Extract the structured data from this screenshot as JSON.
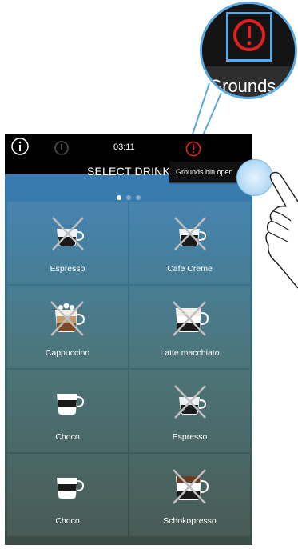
{
  "zoom_callout": {
    "label": "Grounds",
    "icon": "alert-icon"
  },
  "status_bar": {
    "time": "03:11",
    "icons": [
      "info-icon",
      "disabled-status-icon",
      "alert-icon"
    ],
    "alert_color": "#e02020"
  },
  "header": {
    "title": "SELECT DRINK"
  },
  "tooltip": {
    "text": "Grounds bin open"
  },
  "pager": {
    "pages": 3,
    "active": 1
  },
  "drinks": [
    {
      "label": "Espresso",
      "icon": "espresso-cup-icon",
      "disabled": true
    },
    {
      "label": "Cafe Creme",
      "icon": "cafe-creme-cup-icon",
      "disabled": true
    },
    {
      "label": "Cappuccino",
      "icon": "cappuccino-cup-icon",
      "disabled": true
    },
    {
      "label": "Latte macchiato",
      "icon": "latte-macchiato-cup-icon",
      "disabled": true
    },
    {
      "label": "Choco",
      "icon": "choco-cup-icon",
      "disabled": false
    },
    {
      "label": "Espresso",
      "icon": "espresso-cup-icon",
      "disabled": true
    },
    {
      "label": "Choco",
      "icon": "choco-cup-icon",
      "disabled": false
    },
    {
      "label": "Schokopresso",
      "icon": "schokopresso-cup-icon",
      "disabled": true
    }
  ],
  "colors": {
    "accent_blue": "#5aa9e2",
    "alert_red": "#e02020"
  }
}
